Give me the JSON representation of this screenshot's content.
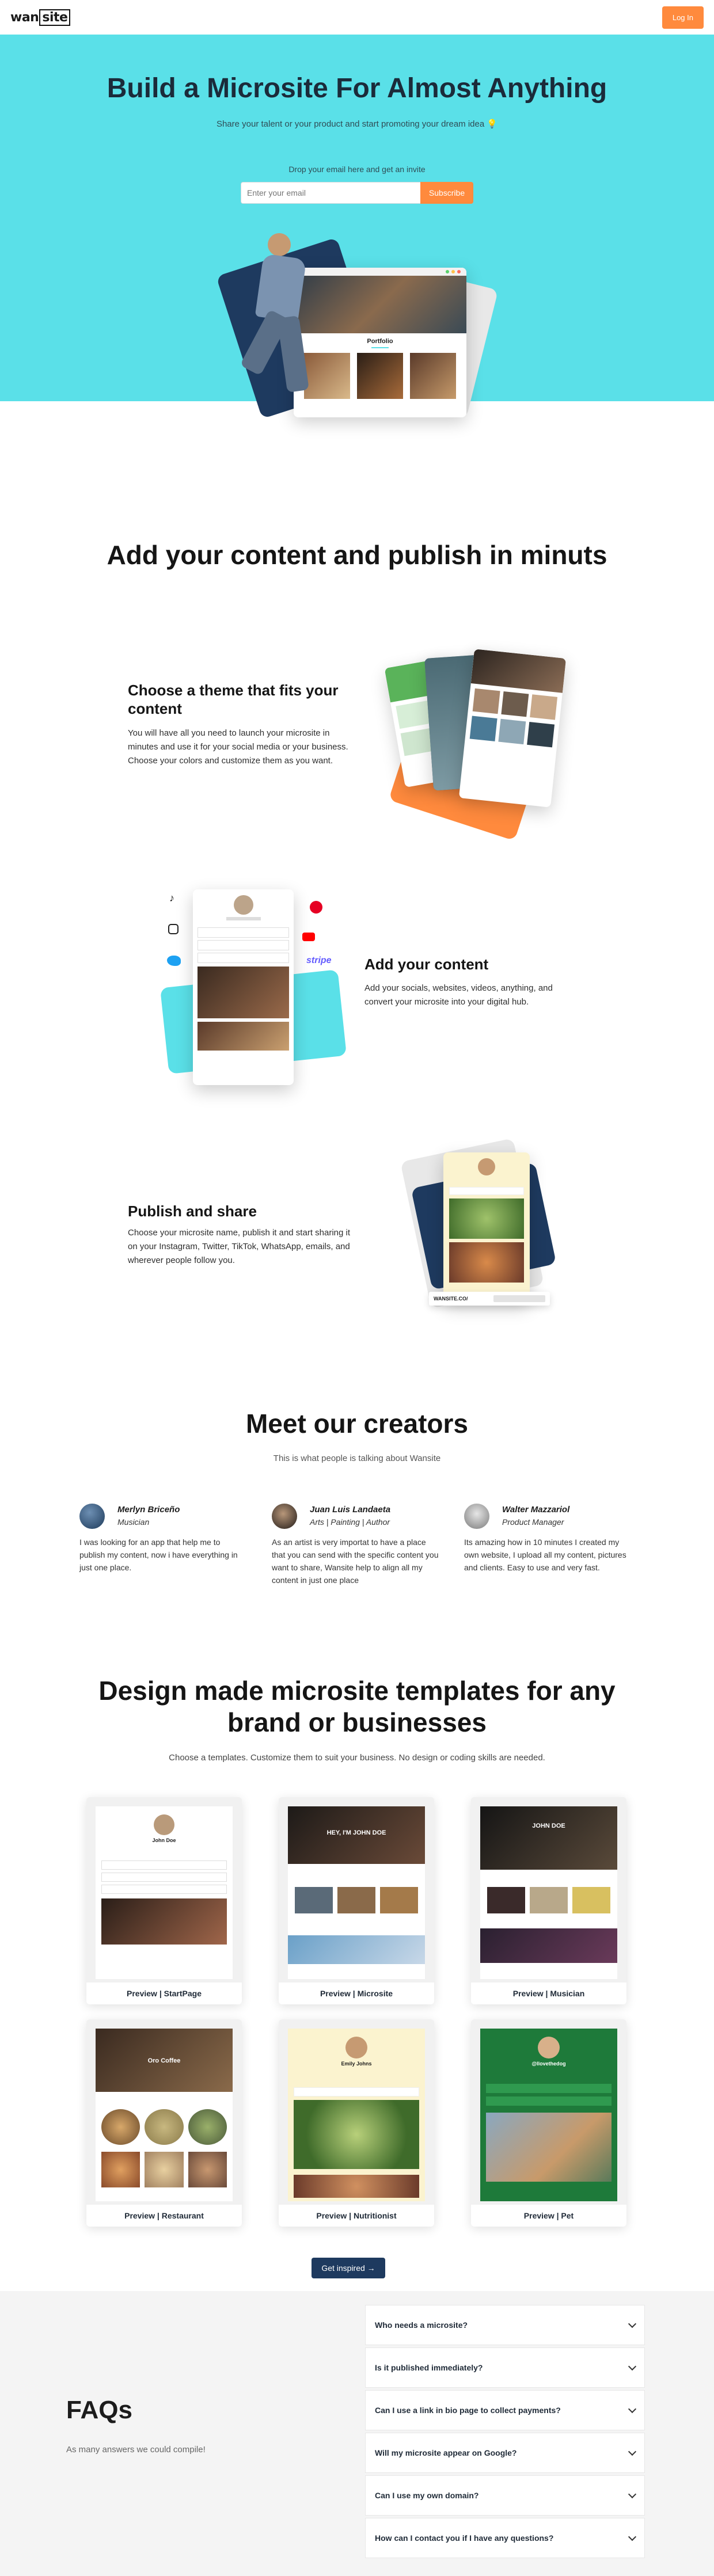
{
  "header": {
    "logo_prefix": "wan",
    "logo_boxed": "site",
    "login_label": "Log In"
  },
  "hero": {
    "title": "Build a Microsite For Almost Anything",
    "subtitle": "Share your talent or your product and start promoting your dream idea 💡",
    "drop_email": "Drop your email here and get an invite",
    "email_placeholder": "Enter your email",
    "subscribe_label": "Subscribe",
    "mock_browser_heading": "Portfolio"
  },
  "content_section": {
    "title": "Add your content and publish in minuts",
    "theme_title": "Choose a theme that fits your content",
    "theme_text": "You will have all you need to launch your microsite in minutes and use it for your social media or your business. Choose your colors and customize them as you want.",
    "add_title": "Add your content",
    "add_text": "Add your socials, websites, videos, anything, and convert your microsite into your digital hub.",
    "publish_title": "Publish and share",
    "publish_text": "Choose your microsite name, publish it and start sharing it on your Instagram, Twitter, TikTok, WhatsApp, emails, and wherever people follow you.",
    "publish_mock_url": "WANSITE.CO/"
  },
  "creators_section": {
    "title": "Meet our creators",
    "subtitle": "This is what people is talking about Wansite",
    "creators": [
      {
        "name": "Merlyn Briceño",
        "role": "Musician",
        "quote": "I was looking for an app that help me to publish my content, now i have everything in just one place."
      },
      {
        "name": "Juan Luis Landaeta",
        "role": "Arts | Painting | Author",
        "quote": "As an artist is very importat to have a place that you can send with the specific content you want to share, Wansite help to align all my content in just one place"
      },
      {
        "name": "Walter Mazzariol",
        "role": "Product Manager",
        "quote": "Its amazing how in 10 minutes I created my own website, I upload all my content, pictures and clients. Easy to use and very fast."
      }
    ]
  },
  "templates_section": {
    "title_line1": "Design made microsite templates for any",
    "title_line2": "brand or businesses",
    "subtitle": "Choose a templates. Customize them to suit your business. No design or coding skills are needed.",
    "templates": [
      {
        "label": "Preview | StartPage",
        "mock_title": "John Doe"
      },
      {
        "label": "Preview | Microsite",
        "mock_title": "HEY, I'M JOHN DOE"
      },
      {
        "label": "Preview | Musician",
        "mock_title": "JOHN DOE"
      },
      {
        "label": "Preview | Restaurant",
        "mock_title": "Oro Coffee"
      },
      {
        "label": "Preview | Nutritionist",
        "mock_title": "Emily Johns"
      },
      {
        "label": "Preview | Pet",
        "mock_title": "@Ilovethedog"
      }
    ],
    "cta_label": "Get inspired →"
  },
  "faq": {
    "title": "FAQs",
    "subtitle": "As many answers we could compile!",
    "questions": [
      "Who needs a microsite?",
      "Is it published immediately?",
      "Can I use a link in bio page to collect payments?",
      "Will my microsite appear on Google?",
      "Can I use my own domain?",
      "How can I contact you if I have any questions?"
    ]
  },
  "colors": {
    "hero_bg": "#5ae0e8",
    "accent_orange": "#ff8a3d",
    "navy": "#1e3a5f"
  }
}
